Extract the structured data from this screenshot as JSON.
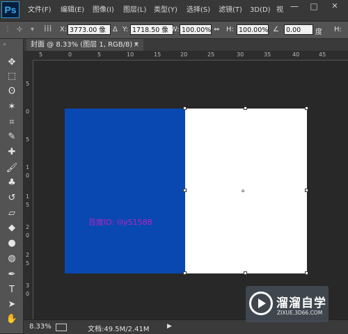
{
  "app": {
    "logo": "Ps"
  },
  "menu": {
    "items": [
      "文件(F)",
      "编辑(E)",
      "图像(I)",
      "图层(L)",
      "类型(Y)",
      "选择(S)",
      "滤镜(T)",
      "3D(D)",
      "视"
    ]
  },
  "window_controls": {
    "minimize": "—",
    "restore": "□",
    "close": "✕"
  },
  "options": {
    "x_label": "X:",
    "x_value": "3773.00 像",
    "y_label": "Y:",
    "y_value": "1718.50 像",
    "w_label": "W:",
    "w_value": "100.00%",
    "link_icon": "⇔",
    "h_label": "H:",
    "h_value": "100.00%",
    "angle_icon": "∠",
    "angle_value": "0.00",
    "angle_unit": "度",
    "warp_label": "H:"
  },
  "document": {
    "tab_title": "封面 @ 8.33% (图层 1, RGB/8) *",
    "tab_close": "×"
  },
  "ruler": {
    "top_ticks": [
      "5",
      "0",
      "5",
      "10",
      "15",
      "20",
      "25",
      "30",
      "35",
      "40",
      "45"
    ],
    "left_ticks": [
      "5",
      "0",
      "5",
      "1",
      "0",
      "1",
      "5",
      "2",
      "0",
      "2",
      "5",
      "3",
      "0"
    ]
  },
  "canvas": {
    "watermark_text": "百度ID: lily51588",
    "blue_color": "#0848b0",
    "white_color": "#ffffff"
  },
  "status": {
    "zoom": "8.33%",
    "doc_size": "文档:49.5M/2.41M",
    "arrow": "▶"
  },
  "brand": {
    "name": "溜溜自学",
    "url": "ZIXUE.3D66.COM"
  },
  "toolbox": {
    "tools": [
      {
        "name": "move-tool",
        "glyph": "✥"
      },
      {
        "name": "marquee-tool",
        "glyph": "⬚"
      },
      {
        "name": "lasso-tool",
        "glyph": "ʘ"
      },
      {
        "name": "magic-wand-tool",
        "glyph": "✶"
      },
      {
        "name": "crop-tool",
        "glyph": "⌗"
      },
      {
        "name": "eyedropper-tool",
        "glyph": "✎"
      },
      {
        "name": "healing-brush-tool",
        "glyph": "✚"
      },
      {
        "name": "brush-tool",
        "glyph": "🖌"
      },
      {
        "name": "clone-stamp-tool",
        "glyph": "♣"
      },
      {
        "name": "history-brush-tool",
        "glyph": "↺"
      },
      {
        "name": "eraser-tool",
        "glyph": "▱"
      },
      {
        "name": "paint-bucket-tool",
        "glyph": "◆"
      },
      {
        "name": "blur-tool",
        "glyph": "●"
      },
      {
        "name": "dodge-tool",
        "glyph": "◍"
      },
      {
        "name": "pen-tool",
        "glyph": "✒"
      },
      {
        "name": "type-tool",
        "glyph": "T"
      },
      {
        "name": "path-selection-tool",
        "glyph": "➤"
      },
      {
        "name": "hand-tool",
        "glyph": "✋"
      }
    ]
  }
}
